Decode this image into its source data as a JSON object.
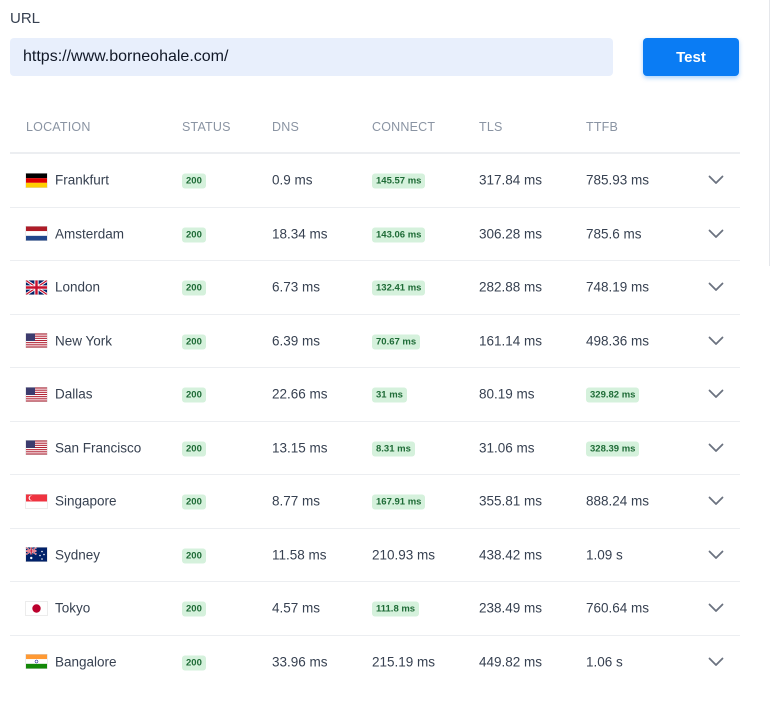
{
  "form": {
    "url_label": "URL",
    "url_value": "https://www.borneohale.com/",
    "test_button": "Test"
  },
  "table": {
    "headers": {
      "location": "LOCATION",
      "status": "STATUS",
      "dns": "DNS",
      "connect": "CONNECT",
      "tls": "TLS",
      "ttfb": "TTFB"
    },
    "rows": [
      {
        "location": "Frankfurt",
        "flag": "germany-flag-icon",
        "status": "200",
        "dns": "0.9 ms",
        "connect": "145.57 ms",
        "connect_highlight": true,
        "tls": "317.84 ms",
        "ttfb": "785.93 ms",
        "ttfb_highlight": false
      },
      {
        "location": "Amsterdam",
        "flag": "netherlands-flag-icon",
        "status": "200",
        "dns": "18.34 ms",
        "connect": "143.06 ms",
        "connect_highlight": true,
        "tls": "306.28 ms",
        "ttfb": "785.6 ms",
        "ttfb_highlight": false
      },
      {
        "location": "London",
        "flag": "uk-flag-icon",
        "status": "200",
        "dns": "6.73 ms",
        "connect": "132.41 ms",
        "connect_highlight": true,
        "tls": "282.88 ms",
        "ttfb": "748.19 ms",
        "ttfb_highlight": false
      },
      {
        "location": "New York",
        "flag": "usa-flag-icon",
        "status": "200",
        "dns": "6.39 ms",
        "connect": "70.67 ms",
        "connect_highlight": true,
        "tls": "161.14 ms",
        "ttfb": "498.36 ms",
        "ttfb_highlight": false
      },
      {
        "location": "Dallas",
        "flag": "usa-flag-icon",
        "status": "200",
        "dns": "22.66 ms",
        "connect": "31 ms",
        "connect_highlight": true,
        "tls": "80.19 ms",
        "ttfb": "329.82 ms",
        "ttfb_highlight": true
      },
      {
        "location": "San Francisco",
        "flag": "usa-flag-icon",
        "status": "200",
        "dns": "13.15 ms",
        "connect": "8.31 ms",
        "connect_highlight": true,
        "tls": "31.06 ms",
        "ttfb": "328.39 ms",
        "ttfb_highlight": true
      },
      {
        "location": "Singapore",
        "flag": "singapore-flag-icon",
        "status": "200",
        "dns": "8.77 ms",
        "connect": "167.91 ms",
        "connect_highlight": true,
        "tls": "355.81 ms",
        "ttfb": "888.24 ms",
        "ttfb_highlight": false
      },
      {
        "location": "Sydney",
        "flag": "australia-flag-icon",
        "status": "200",
        "dns": "11.58 ms",
        "connect": "210.93 ms",
        "connect_highlight": false,
        "tls": "438.42 ms",
        "ttfb": "1.09 s",
        "ttfb_highlight": false
      },
      {
        "location": "Tokyo",
        "flag": "japan-flag-icon",
        "status": "200",
        "dns": "4.57 ms",
        "connect": "111.8 ms",
        "connect_highlight": true,
        "tls": "238.49 ms",
        "ttfb": "760.64 ms",
        "ttfb_highlight": false
      },
      {
        "location": "Bangalore",
        "flag": "india-flag-icon",
        "status": "200",
        "dns": "33.96 ms",
        "connect": "215.19 ms",
        "connect_highlight": false,
        "tls": "449.82 ms",
        "ttfb": "1.06 s",
        "ttfb_highlight": false
      }
    ],
    "expand_icon": "chevron-down-icon"
  },
  "colors": {
    "accent": "#0a7cf4",
    "input_bg": "#e8effc",
    "badge_bg": "#d5f1dc",
    "badge_text": "#1e6b36",
    "header_text": "#8a94a3"
  }
}
